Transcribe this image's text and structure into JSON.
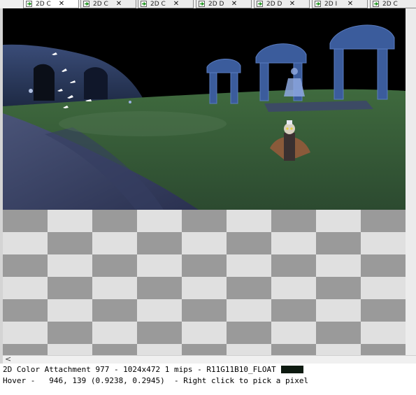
{
  "tabs": [
    {
      "label": "2D C",
      "close": "✕",
      "icon": "document-arrow-icon"
    },
    {
      "label": "2D C",
      "close": "✕",
      "icon": "document-arrow-icon"
    },
    {
      "label": "2D C",
      "close": "✕",
      "icon": "document-arrow-icon"
    },
    {
      "label": "2D D",
      "close": "✕",
      "icon": "document-arrow-icon"
    },
    {
      "label": "2D D",
      "close": "✕",
      "icon": "document-arrow-icon"
    },
    {
      "label": "2D I",
      "close": "✕",
      "icon": "document-arrow-icon"
    },
    {
      "label": "2D C",
      "close": "",
      "icon": "document-arrow-icon"
    }
  ],
  "scrollbar": {
    "left_arrow": "<"
  },
  "status": {
    "line1": "2D Color Attachment 977 - 1024x472 1 mips - R11G11B10_FLOAT",
    "line2": "Hover -   946, 139 (0.9238, 0.2945)  - Right click to pick a pixel",
    "swatch_color": "#0d1a10"
  },
  "colors": {
    "sky": "#000000",
    "grass": "#3b5a3a",
    "ruins": "#3a5a9a",
    "checker_light": "#e0e0e0",
    "checker_dark": "#9a9a9a"
  }
}
